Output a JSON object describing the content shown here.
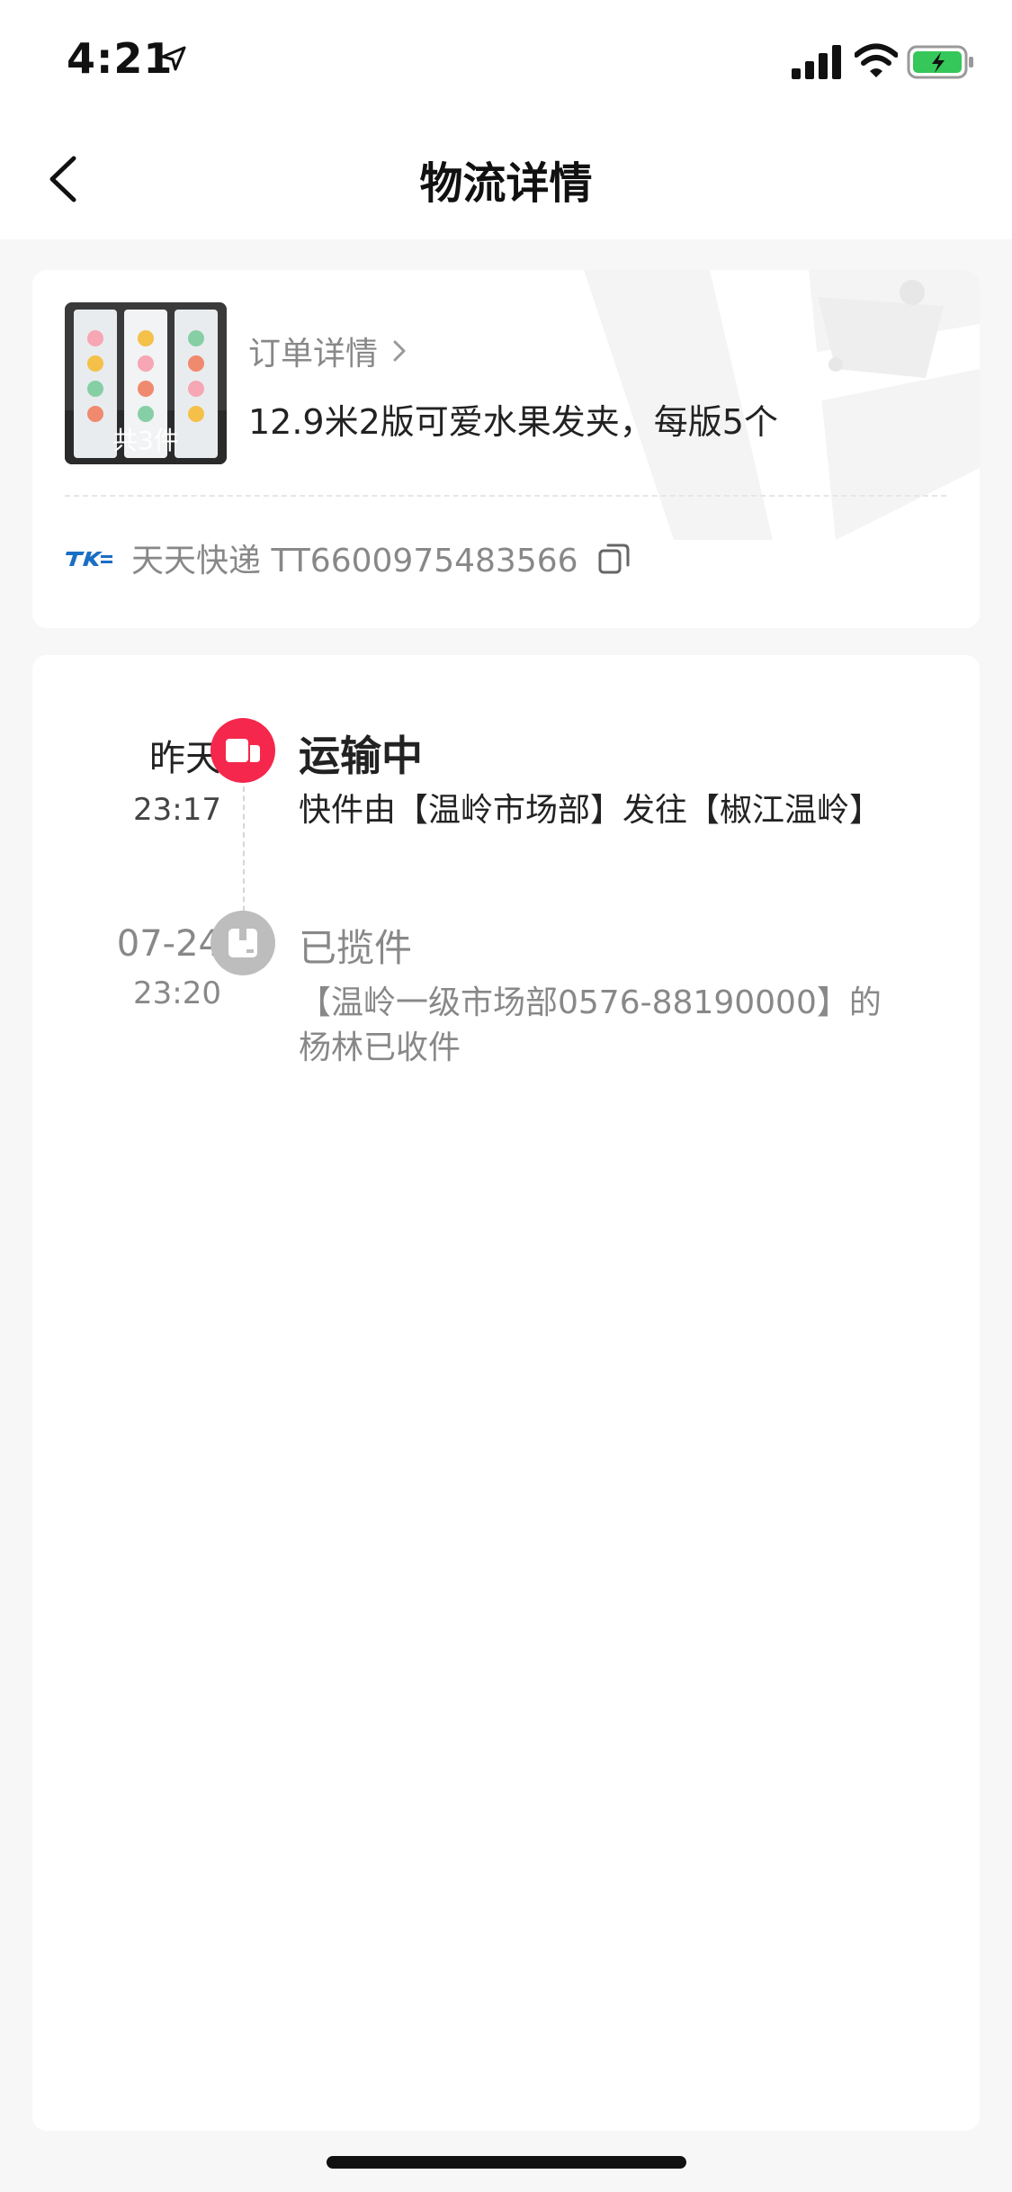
{
  "status_bar": {
    "time": "4:21"
  },
  "nav": {
    "title": "物流详情"
  },
  "order": {
    "thumb_count": "共3件",
    "order_link": "订单详情",
    "product_name": "12.9米2版可爱水果发夹，每版5个",
    "carrier": "天天快递 TT6600975483566"
  },
  "tracking": {
    "events": [
      {
        "date": "昨天",
        "time": "23:17",
        "status": "运输中",
        "description": "快件由【温岭市场部】发往【椒江温岭】"
      },
      {
        "date": "07-24",
        "time": "23:20",
        "status": "已揽件",
        "description": "【温岭一级市场部0576-88190000】的杨林已收件"
      }
    ]
  },
  "colors": {
    "accent": "#f5274c",
    "muted_icon": "#bdbdbd"
  }
}
